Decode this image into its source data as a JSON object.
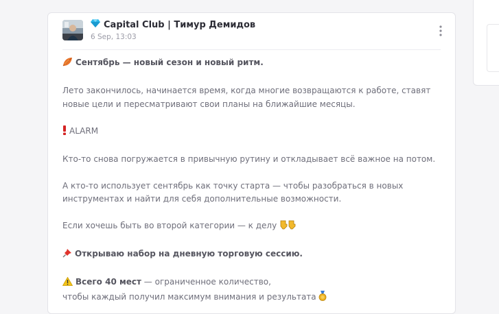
{
  "post": {
    "channel_name": "Capital Club | Тимур Демидов",
    "timestamp": "6 Sep, 13:03",
    "paragraphs": [
      {
        "icon": "leaf-icon",
        "text": "Сентябрь — новый сезон и новый ритм.",
        "bold": true
      },
      {
        "text": "Лето закончилось, начинается время, когда многие возвращаются к работе, ставят новые цели и пересматривают свои планы на ближайшие месяцы."
      },
      {
        "icon": "exclamation-icon",
        "text": "ALARM"
      },
      {
        "text": "Кто-то снова погружается в привычную рутину и откладывает всё важное на потом."
      },
      {
        "text": "А кто-то использует сентябрь как точку старта — чтобы разобраться в новых инструментах и найти для себя дополнительные возможности."
      },
      {
        "text": "Если хочешь быть во второй категории — к делу",
        "trailing_icons": [
          "pointing-down-icon",
          "pointing-down-icon"
        ]
      },
      {
        "icon": "pushpin-icon",
        "text": "Открываю набор на дневную торговую сессию.",
        "bold": true
      },
      {
        "icon": "warning-icon",
        "bold_prefix": "Всего 40 мест",
        "text_line1": " — ограниченное количество,",
        "text_line2": "чтобы каждый получил максимум внимания и результата",
        "trailing_icons": [
          "medal-icon"
        ]
      }
    ]
  },
  "colors": {
    "accent_diamond": "#2bb6e8",
    "background": "#f5f5f7",
    "card": "#ffffff"
  }
}
